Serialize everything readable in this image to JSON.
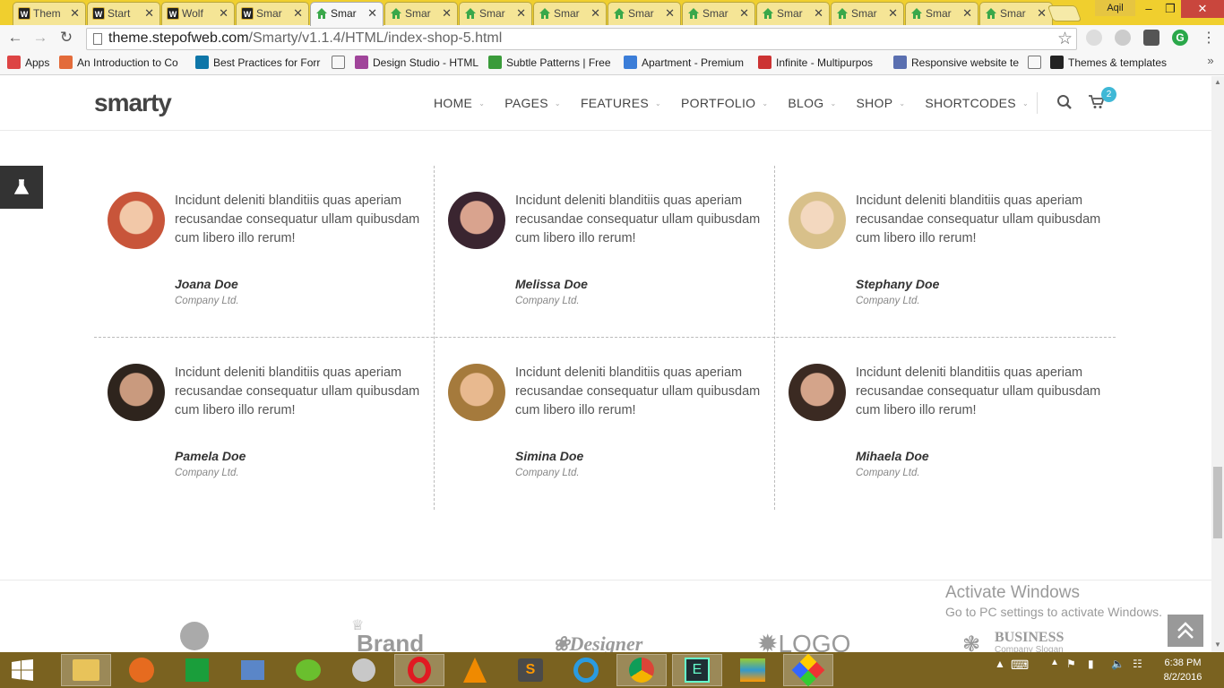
{
  "browser": {
    "tabs": [
      {
        "label": "Them",
        "favicon": "w-icon"
      },
      {
        "label": "Start",
        "favicon": "w-icon"
      },
      {
        "label": "Wolf",
        "favicon": "w-icon"
      },
      {
        "label": "Smar",
        "favicon": "w-icon"
      },
      {
        "label": "Smar",
        "favicon": "home-icon",
        "active": true
      },
      {
        "label": "Smar",
        "favicon": "home-icon"
      },
      {
        "label": "Smar",
        "favicon": "home-icon"
      },
      {
        "label": "Smar",
        "favicon": "home-icon"
      },
      {
        "label": "Smar",
        "favicon": "home-icon"
      },
      {
        "label": "Smar",
        "favicon": "home-icon"
      },
      {
        "label": "Smar",
        "favicon": "home-icon"
      },
      {
        "label": "Smar",
        "favicon": "home-icon"
      },
      {
        "label": "Smar",
        "favicon": "home-icon"
      },
      {
        "label": "Smar",
        "favicon": "home-icon"
      }
    ],
    "user": "Aqil",
    "address_host": "theme.stepofweb.com",
    "address_path": "/Smarty/v1.1.4/HTML/index-shop-5.html",
    "bookmarks": [
      {
        "label": "Apps",
        "icon": "apps-grid-icon",
        "color": "#d44"
      },
      {
        "label": "An Introduction to Co",
        "icon": "plus-icon",
        "color": "#e36b3a"
      },
      {
        "label": "Best Practices for Forr",
        "icon": "linkedin-icon",
        "color": "#0e76a8"
      },
      {
        "label": "",
        "icon": "page-icon",
        "color": "#888"
      },
      {
        "label": "Design Studio - HTML",
        "icon": "d-icon",
        "color": "#a0449a"
      },
      {
        "label": "Subtle Patterns | Free",
        "icon": "pattern-icon",
        "color": "#3a9b3a"
      },
      {
        "label": "Apartment - Premium",
        "icon": "house-icon",
        "color": "#3b7dd8"
      },
      {
        "label": "Infinite - Multipurpos",
        "icon": "wp-icon",
        "color": "#c33"
      },
      {
        "label": "Responsive website te",
        "icon": "shield-icon",
        "color": "#5a6fb0"
      },
      {
        "label": "",
        "icon": "page-icon",
        "color": "#888"
      },
      {
        "label": "Themes & templates",
        "icon": "w-icon",
        "color": "#222"
      }
    ]
  },
  "site": {
    "logo": "smarty",
    "nav": [
      "HOME",
      "PAGES",
      "FEATURES",
      "PORTFOLIO",
      "BLOG",
      "SHOP",
      "SHORTCODES"
    ],
    "cart_count": "2"
  },
  "testimonials": [
    {
      "quote": "Incidunt deleniti blanditiis quas aperiam recusandae consequatur ullam quibusdam cum libero illo rerum!",
      "name": "Joana Doe",
      "company": "Company Ltd."
    },
    {
      "quote": "Incidunt deleniti blanditiis quas aperiam recusandae consequatur ullam quibusdam cum libero illo rerum!",
      "name": "Melissa Doe",
      "company": "Company Ltd."
    },
    {
      "quote": "Incidunt deleniti blanditiis quas aperiam recusandae consequatur ullam quibusdam cum libero illo rerum!",
      "name": "Stephany Doe",
      "company": "Company Ltd."
    },
    {
      "quote": "Incidunt deleniti blanditiis quas aperiam recusandae consequatur ullam quibusdam cum libero illo rerum!",
      "name": "Pamela Doe",
      "company": "Company Ltd."
    },
    {
      "quote": "Incidunt deleniti blanditiis quas aperiam recusandae consequatur ullam quibusdam cum libero illo rerum!",
      "name": "Simina Doe",
      "company": "Company Ltd."
    },
    {
      "quote": "Incidunt deleniti blanditiis quas aperiam recusandae consequatur ullam quibusdam cum libero illo rerum!",
      "name": "Mihaela Doe",
      "company": "Company Ltd."
    }
  ],
  "brands": {
    "brand": "Brand",
    "designer": "Designer",
    "logo": "LOGO",
    "business": "BUSINESS",
    "business_slogan": "Company Slogan"
  },
  "watermark": {
    "title": "Activate Windows",
    "subtitle": "Go to PC settings to activate Windows."
  },
  "taskbar": {
    "time": "6:38 PM",
    "date": "8/2/2016"
  }
}
